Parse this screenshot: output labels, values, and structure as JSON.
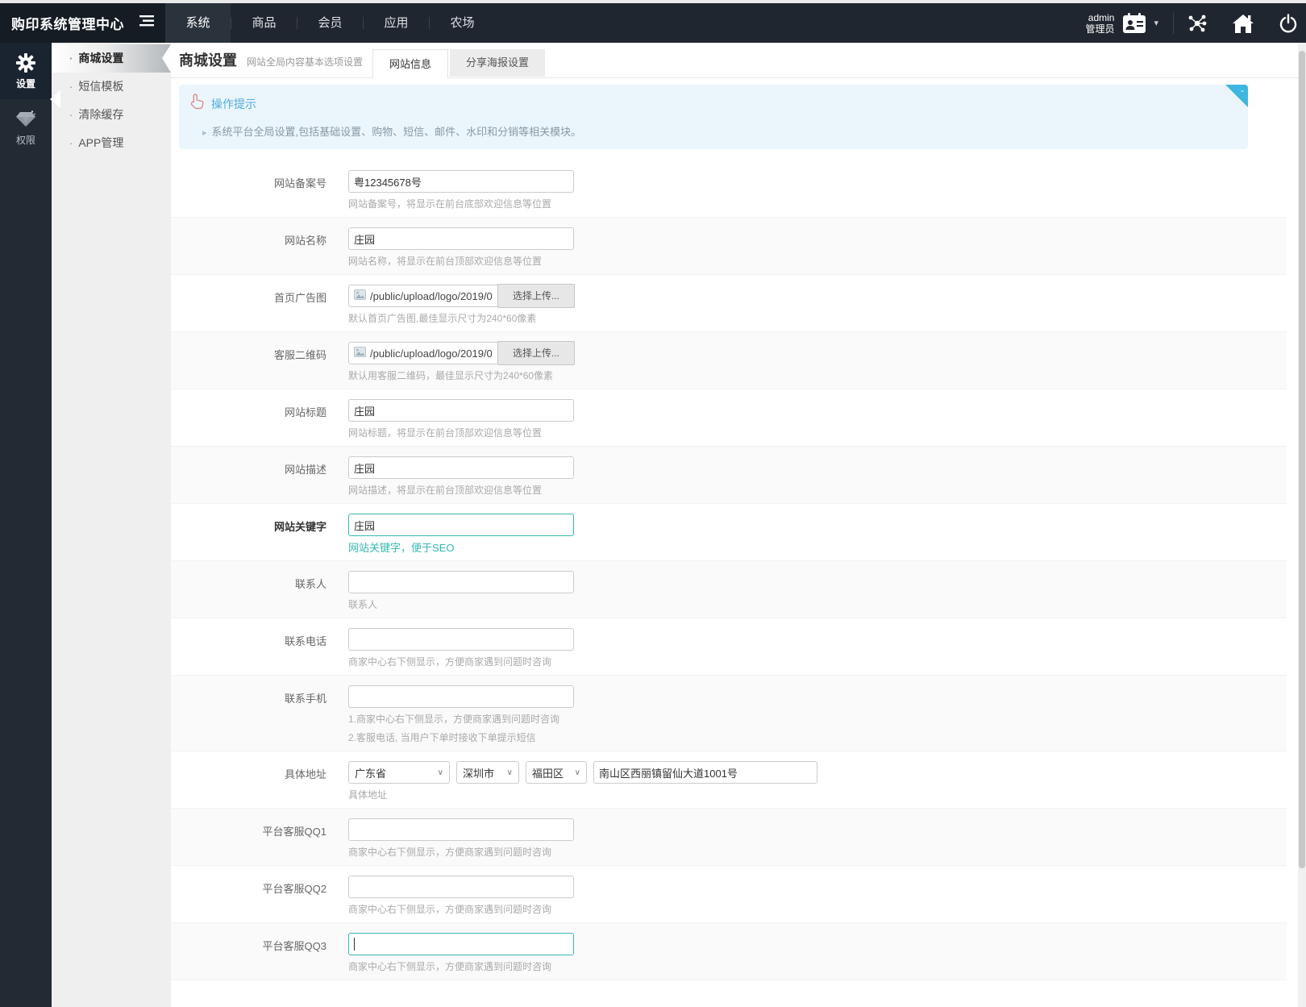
{
  "colors": {
    "accent": "#36b8b0",
    "tip_title": "#54abde",
    "tip_bg": "#eaf6fb",
    "tip_fold": "#3fb6e0",
    "navbar_bg": "#20262f",
    "sidebar_bg": "#222a34"
  },
  "navbar": {
    "brand": "购印系统管理中心",
    "toggle_icon": "menu-fold-icon",
    "items": [
      {
        "label": "系统",
        "active": true
      },
      {
        "label": "商品",
        "active": false
      },
      {
        "label": "会员",
        "active": false
      },
      {
        "label": "应用",
        "active": false
      },
      {
        "label": "农场",
        "active": false
      }
    ],
    "user_name": "admin",
    "user_role": "管理员",
    "right_icons": [
      "id-badge-icon",
      "caret-down-icon",
      "share-nodes-icon",
      "home-icon",
      "power-icon"
    ]
  },
  "sidebar": {
    "items": [
      {
        "label": "设置",
        "icon": "gear-icon",
        "active": true
      },
      {
        "label": "权限",
        "icon": "gem-icon",
        "active": false
      }
    ],
    "submenu": [
      {
        "label": "商城设置",
        "active": true
      },
      {
        "label": "短信模板",
        "active": false
      },
      {
        "label": "清除缓存",
        "active": false
      },
      {
        "label": "APP管理",
        "active": false
      }
    ]
  },
  "header": {
    "title": "商城设置",
    "subtitle": "网站全局内容基本选项设置",
    "tabs": [
      {
        "label": "网站信息",
        "active": true
      },
      {
        "label": "分享海报设置",
        "active": false
      }
    ]
  },
  "tip": {
    "icon": "hand-pointer-icon",
    "title": "操作提示",
    "collapse_label": "-",
    "text": "系统平台全局设置,包括基础设置、购物、短信、邮件、水印和分销等相关模块。"
  },
  "form": {
    "fields": [
      {
        "key": "icp-number",
        "label": "网站备案号",
        "type": "text",
        "value": "粤12345678号",
        "help": [
          "网站备案号，将显示在前台底部欢迎信息等位置"
        ]
      },
      {
        "key": "site-name",
        "label": "网站名称",
        "type": "text",
        "value": "庄园",
        "help": [
          "网站名称，将显示在前台顶部欢迎信息等位置"
        ]
      },
      {
        "key": "home-banner",
        "label": "首页广告图",
        "type": "file",
        "value": "/public/upload/logo/2019/0",
        "button": "选择上传...",
        "help": [
          "默认首页广告图,最佳显示尺寸为240*60像素"
        ]
      },
      {
        "key": "service-qrcode",
        "label": "客服二维码",
        "type": "file",
        "value": "/public/upload/logo/2019/0",
        "button": "选择上传...",
        "help": [
          "默认用客服二维码，最佳显示尺寸为240*60像素"
        ]
      },
      {
        "key": "site-title",
        "label": "网站标题",
        "type": "text",
        "value": "庄园",
        "help": [
          "网站标题，将显示在前台顶部欢迎信息等位置"
        ]
      },
      {
        "key": "site-description",
        "label": "网站描述",
        "type": "text",
        "value": "庄园",
        "help": [
          "网站描述，将显示在前台顶部欢迎信息等位置"
        ]
      },
      {
        "key": "site-keywords",
        "label": "网站关键字",
        "type": "text",
        "value": "庄园",
        "focused": true,
        "label_bold": true,
        "help_accent": true,
        "help": [
          "网站关键字，便于SEO"
        ]
      },
      {
        "key": "contact-person",
        "label": "联系人",
        "type": "text",
        "value": "",
        "help": [
          "联系人"
        ]
      },
      {
        "key": "contact-phone",
        "label": "联系电话",
        "type": "text",
        "value": "",
        "help": [
          "商家中心右下侧显示，方便商家遇到问题时咨询"
        ]
      },
      {
        "key": "contact-mobile",
        "label": "联系手机",
        "type": "text",
        "value": "",
        "help": [
          "1.商家中心右下侧显示，方便商家遇到问题时咨询",
          "2.客服电话, 当用户下单时接收下单提示短信"
        ]
      },
      {
        "key": "address",
        "label": "具体地址",
        "type": "address",
        "selects": [
          {
            "name": "province-select",
            "value": "广东省"
          },
          {
            "name": "city-select",
            "value": "深圳市"
          },
          {
            "name": "district-select",
            "value": "福田区"
          }
        ],
        "value": "南山区西丽镇留仙大道1001号",
        "help": [
          "具体地址"
        ]
      },
      {
        "key": "qq1",
        "label": "平台客服QQ1",
        "type": "text",
        "value": "",
        "help": [
          "商家中心右下侧显示，方便商家遇到问题时咨询"
        ]
      },
      {
        "key": "qq2",
        "label": "平台客服QQ2",
        "type": "text",
        "value": "",
        "help": [
          "商家中心右下侧显示，方便商家遇到问题时咨询"
        ]
      },
      {
        "key": "qq3",
        "label": "平台客服QQ3",
        "type": "text",
        "value": "",
        "focused": true,
        "show_caret": true,
        "help": [
          "商家中心右下侧显示，方便商家遇到问题时咨询"
        ]
      }
    ]
  }
}
